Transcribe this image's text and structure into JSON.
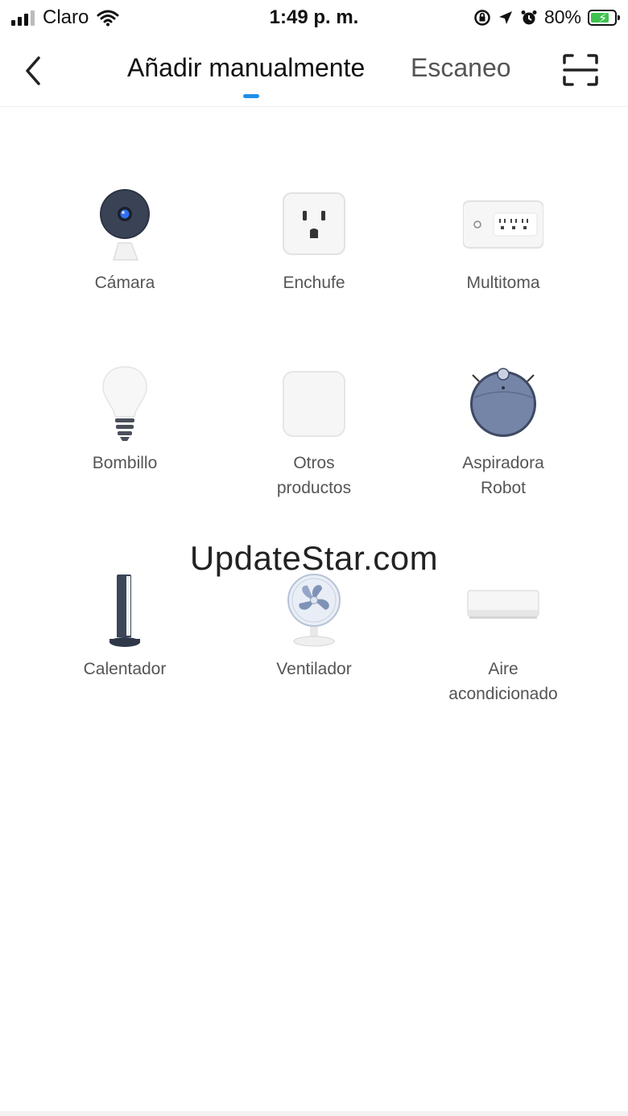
{
  "status_bar": {
    "carrier": "Claro",
    "time": "1:49 p. m.",
    "battery": "80%",
    "battery_level": 0.8
  },
  "header": {
    "tabs": [
      {
        "label": "Añadir manualmente",
        "active": true
      },
      {
        "label": "Escaneo",
        "active": false
      }
    ],
    "accent_color": "#1e90e8"
  },
  "devices": [
    {
      "label_lines": [
        "Cámara"
      ],
      "icon": "camera-icon"
    },
    {
      "label_lines": [
        "Enchufe"
      ],
      "icon": "plug-icon"
    },
    {
      "label_lines": [
        "Multitoma"
      ],
      "icon": "power-strip-icon"
    },
    {
      "label_lines": [
        "Bombillo"
      ],
      "icon": "bulb-icon"
    },
    {
      "label_lines": [
        "Otros",
        "productos"
      ],
      "icon": "other-products-icon"
    },
    {
      "label_lines": [
        "Aspiradora",
        "Robot"
      ],
      "icon": "robot-vacuum-icon"
    },
    {
      "label_lines": [
        "Calentador"
      ],
      "icon": "heater-icon"
    },
    {
      "label_lines": [
        "Ventilador"
      ],
      "icon": "fan-icon"
    },
    {
      "label_lines": [
        "Aire",
        "acondicionado"
      ],
      "icon": "air-conditioner-icon"
    }
  ],
  "watermark": "UpdateStar.com"
}
